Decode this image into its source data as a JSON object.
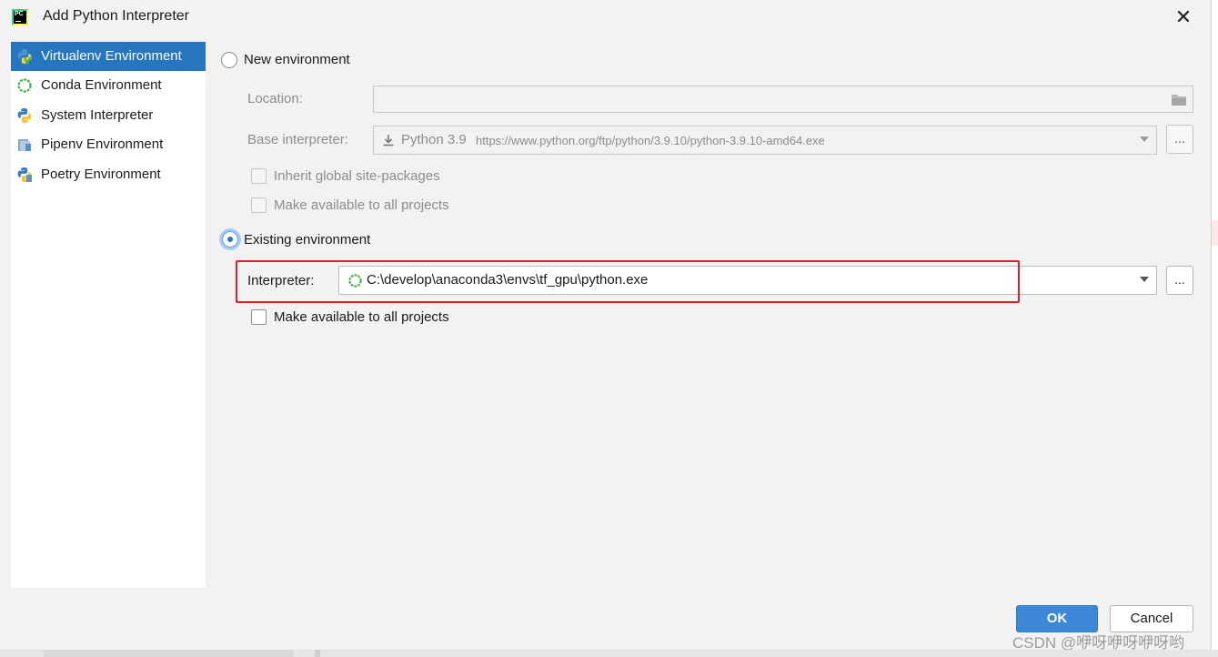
{
  "window": {
    "title": "Add Python Interpreter",
    "app_icon_text": "PC",
    "close_glyph": "✕"
  },
  "sidebar": {
    "items": [
      {
        "label": "Virtualenv Environment",
        "icon": "virtualenv-icon",
        "selected": true
      },
      {
        "label": "Conda Environment",
        "icon": "conda-icon",
        "selected": false
      },
      {
        "label": "System Interpreter",
        "icon": "python-icon",
        "selected": false
      },
      {
        "label": "Pipenv Environment",
        "icon": "pipenv-icon",
        "selected": false
      },
      {
        "label": "Poetry Environment",
        "icon": "poetry-icon",
        "selected": false
      }
    ]
  },
  "new_env": {
    "label": "New environment",
    "selected": false,
    "location_label": "Location:",
    "location_value": "",
    "base_label": "Base interpreter:",
    "base_name": "Python 3.9",
    "base_url": "https://www.python.org/ftp/python/3.9.10/python-3.9.10-amd64.exe",
    "inherit_label": "Inherit global site-packages",
    "make_available_label": "Make available to all projects",
    "browse_label": "..."
  },
  "existing_env": {
    "label": "Existing environment",
    "selected": true,
    "interpreter_label": "Interpreter:",
    "interpreter_value": "C:\\develop\\anaconda3\\envs\\tf_gpu\\python.exe",
    "make_available_label": "Make available to all projects",
    "browse_label": "..."
  },
  "buttons": {
    "ok": "OK",
    "cancel": "Cancel"
  },
  "watermark": "CSDN @咿呀咿呀咿呀哟",
  "colors": {
    "selection": "#2675bf",
    "primary_button": "#3d87d6",
    "highlight_box": "#e02020"
  }
}
